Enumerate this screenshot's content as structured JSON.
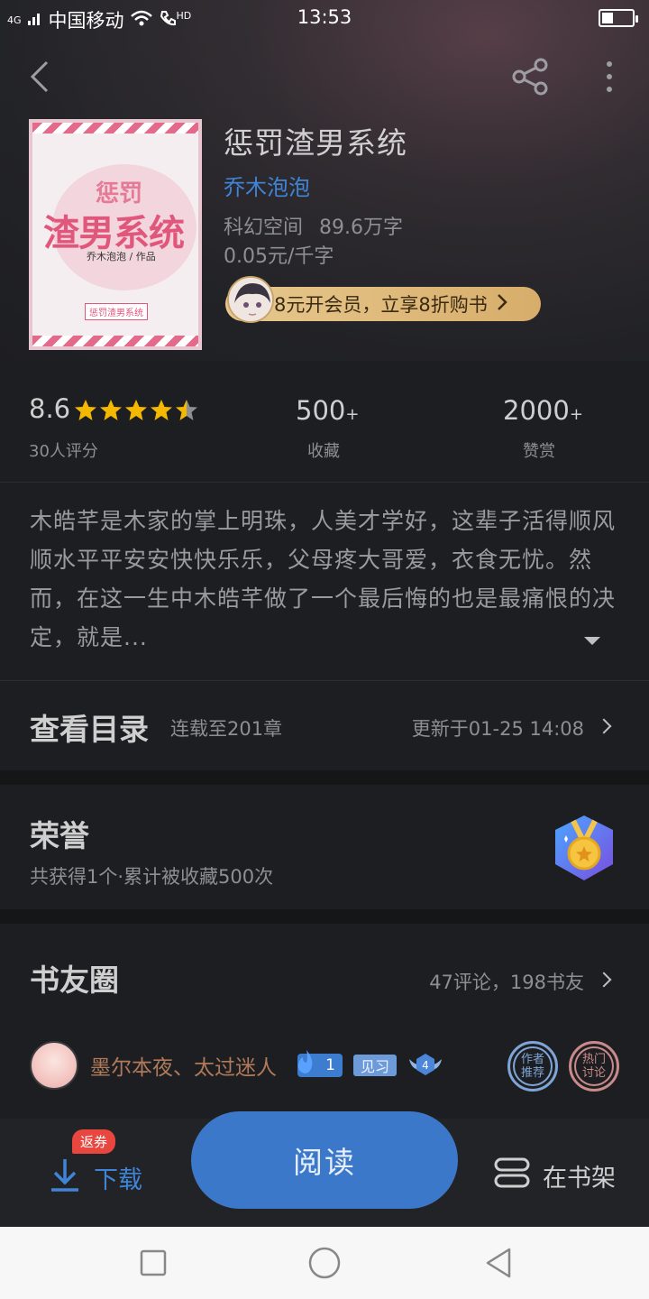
{
  "status_bar": {
    "network": "4G",
    "carrier": "中国移动",
    "hd": "HD",
    "time": "13:53"
  },
  "book": {
    "title": "惩罚渣男系统",
    "author": "乔木泡泡",
    "category": "科幻空间",
    "word_count": "89.6万字",
    "price": "0.05元/千字",
    "vip_promo": "8元开会员，立享8折购书",
    "cover": {
      "top_text": "惩罚",
      "main_text": "渣男系统",
      "byline": "乔木泡泡 / 作品",
      "tag": "惩罚渣男系统"
    }
  },
  "stats": {
    "score": "8.6",
    "rating_stars": 4.5,
    "rating_count": "30人评分",
    "favorites": "500",
    "favorites_suffix": "+",
    "favorites_label": "收藏",
    "likes": "2000",
    "likes_suffix": "+",
    "likes_label": "赞赏"
  },
  "description": "木皓芊是木家的掌上明珠，人美才学好，这辈子活得顺风顺水平平安安快快乐乐，父母疼大哥爱，衣食无忧。然而，在这一生中木皓芊做了一个最后悔的也是最痛恨的决定，就是...",
  "toc": {
    "title": "查看目录",
    "progress": "连载至201章",
    "updated": "更新于01-25 14:08"
  },
  "honor": {
    "title": "荣誉",
    "summary": "共获得1个·累计被收藏500次"
  },
  "book_circle": {
    "title": "书友圈",
    "stats": "47评论，198书友",
    "first_post": {
      "username": "墨尔本夜、太过迷人",
      "fan_level": "1",
      "tag": "见习",
      "wing_level": "4",
      "stamps": [
        {
          "line1": "作者",
          "line2": "推荐"
        },
        {
          "line1": "热门",
          "line2": "讨论"
        }
      ]
    }
  },
  "actions": {
    "coupon_badge": "返券",
    "download": "下载",
    "read": "阅读",
    "on_shelf": "在书架"
  },
  "colors": {
    "accent": "#3b78c9",
    "link": "#3f84d6",
    "star": "#f5b800",
    "vip_gold": "#dcb574"
  }
}
